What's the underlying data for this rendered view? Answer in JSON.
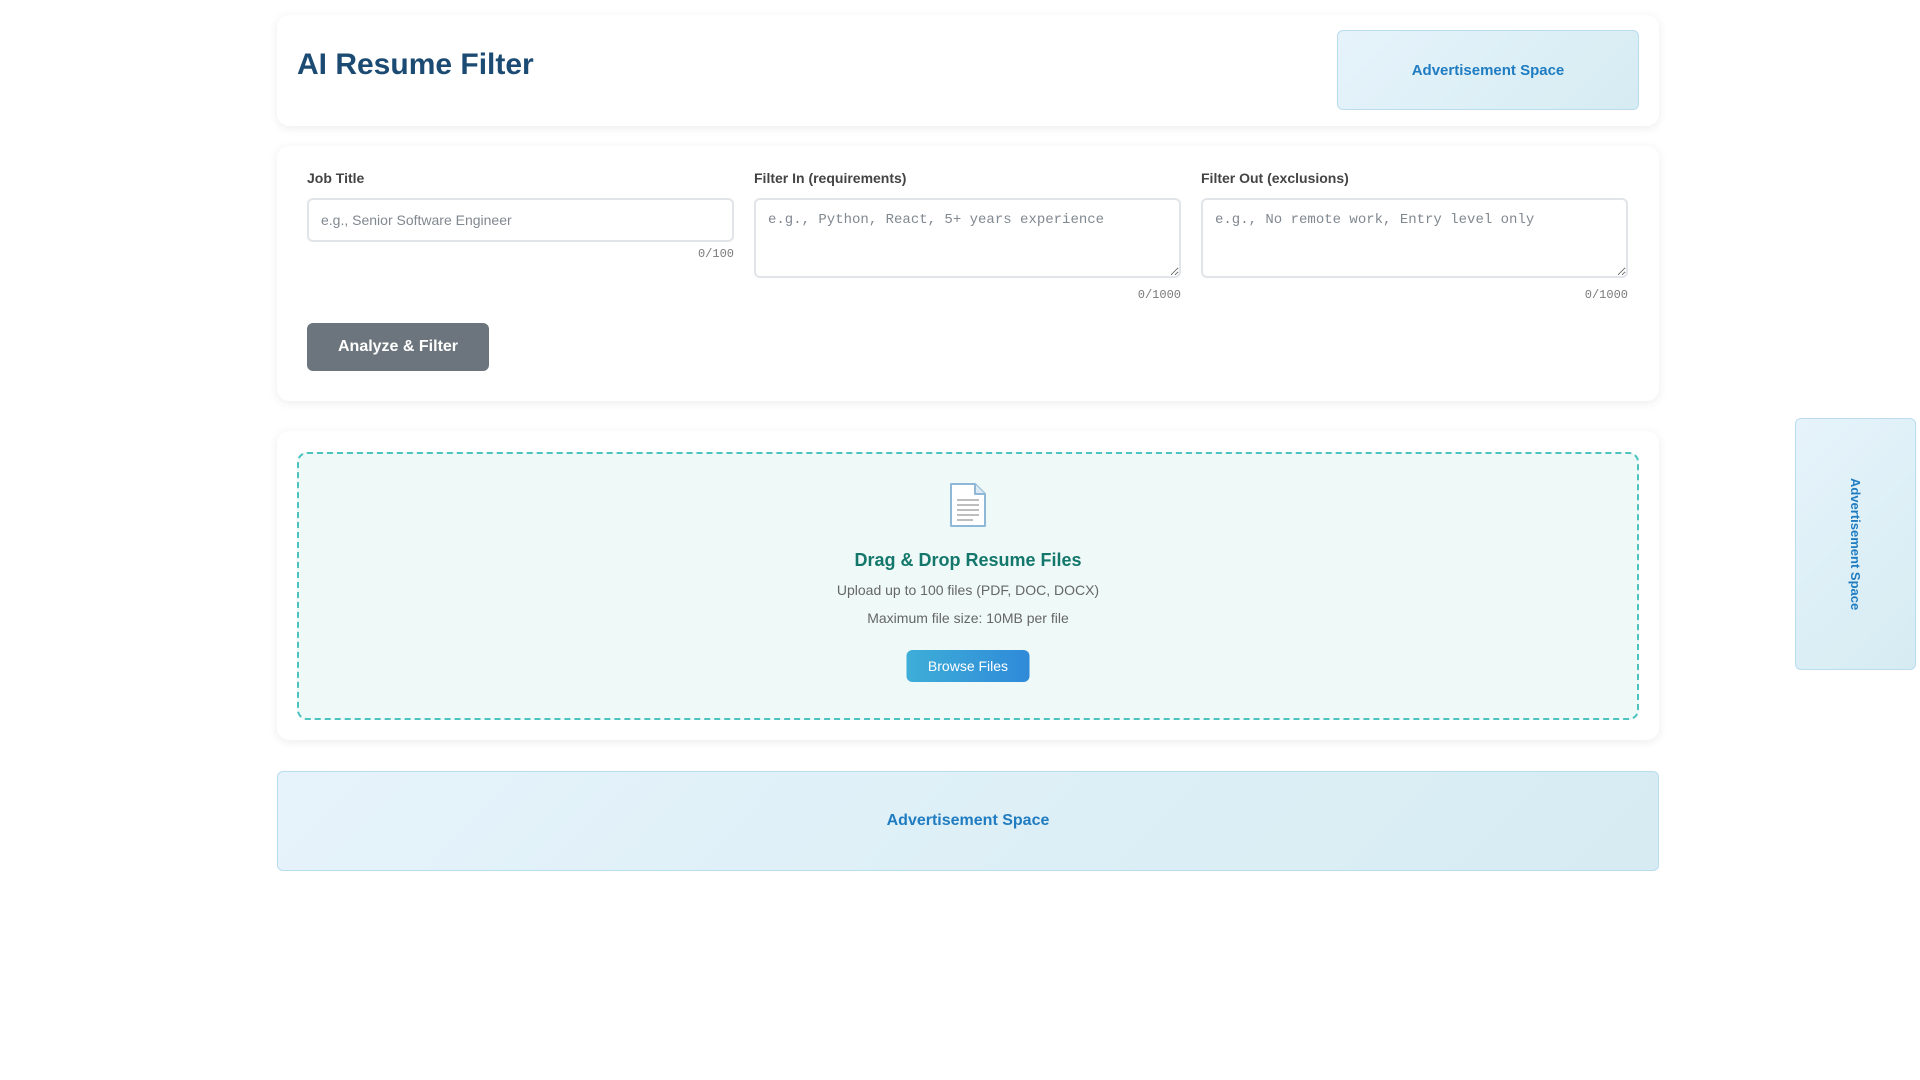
{
  "header": {
    "title": "AI Resume Filter",
    "ad_label": "Advertisement Space"
  },
  "form": {
    "job_title": {
      "label": "Job Title",
      "placeholder": "e.g., Senior Software Engineer",
      "value": "",
      "counter": "0/100"
    },
    "filter_in": {
      "label": "Filter In (requirements)",
      "placeholder": "e.g., Python, React, 5+ years experience",
      "value": "",
      "counter": "0/1000"
    },
    "filter_out": {
      "label": "Filter Out (exclusions)",
      "placeholder": "e.g., No remote work, Entry level only",
      "value": "",
      "counter": "0/1000"
    },
    "analyze_label": "Analyze & Filter"
  },
  "upload": {
    "icon": "document-icon",
    "title": "Drag & Drop Resume Files",
    "subtitle": "Upload up to 100 files (PDF, DOC, DOCX)",
    "max_size": "Maximum file size: 10MB per file",
    "browse_label": "Browse Files"
  },
  "ads": {
    "bottom_label": "Advertisement Space",
    "side_label": "Advertisement Space"
  },
  "colors": {
    "title": "#1b4a72",
    "ad_text": "#1f7cc1",
    "analyze_button": "#6c757d",
    "dropzone_border": "#4cc3bf",
    "drop_title": "#13786b",
    "browse_button": "#2f8ad9"
  }
}
